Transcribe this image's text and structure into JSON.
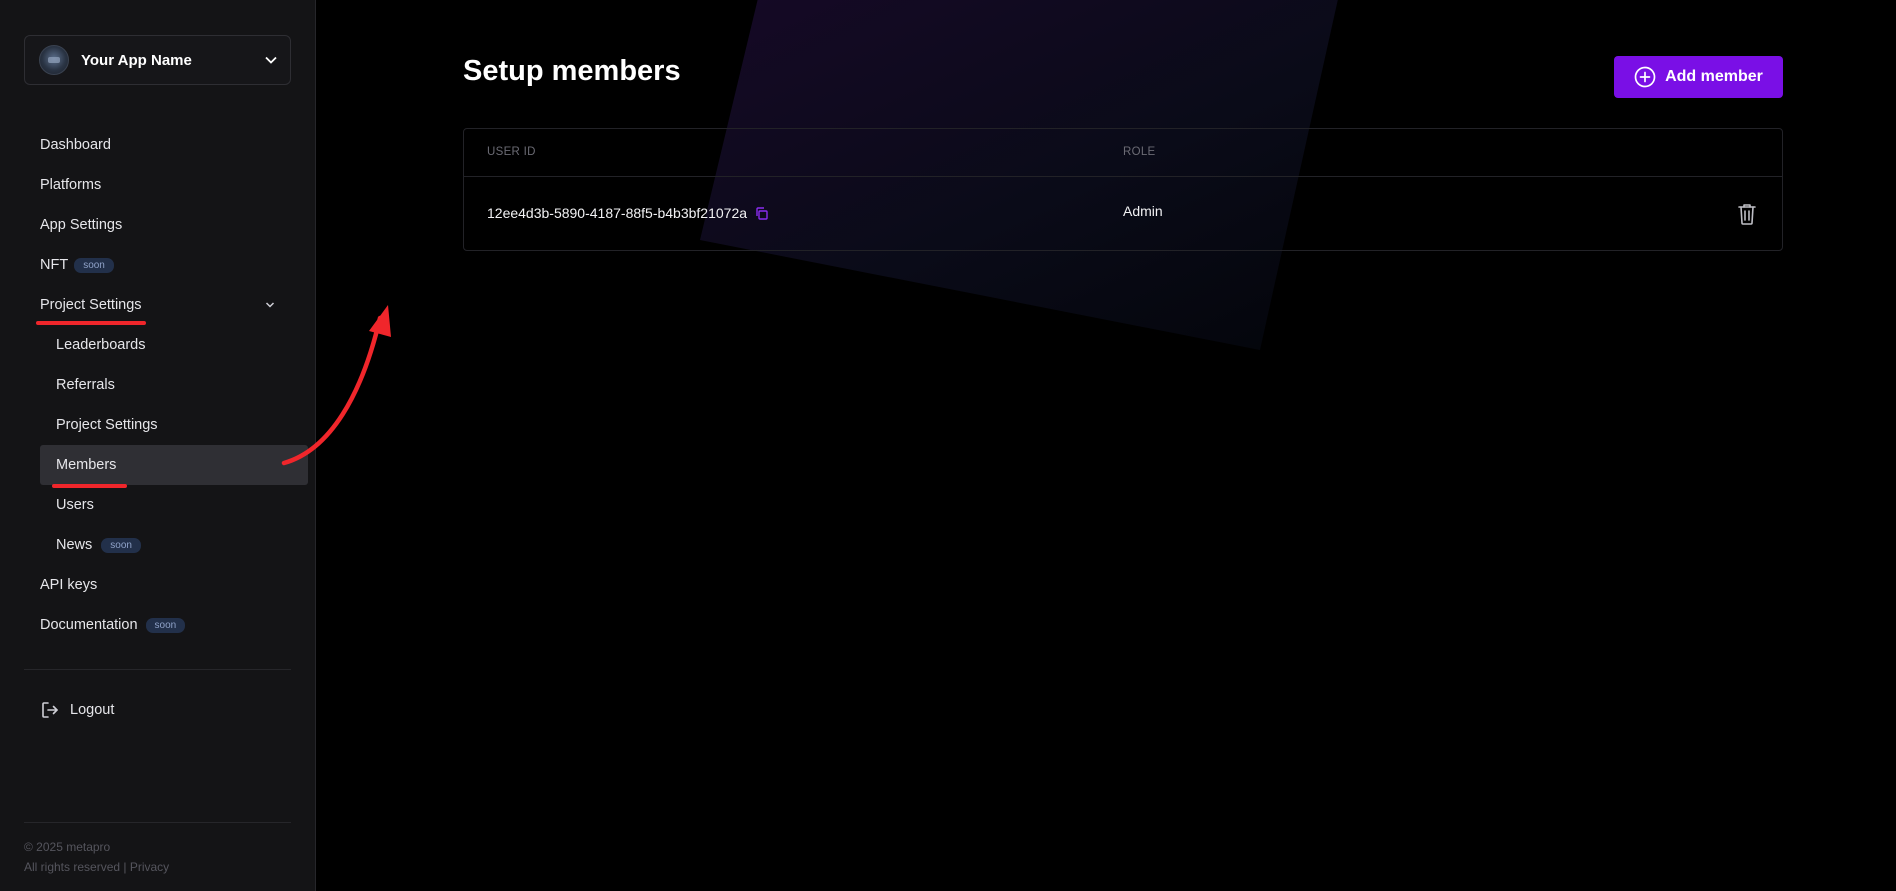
{
  "app_switcher": {
    "name": "Your App Name"
  },
  "sidebar": {
    "items": [
      {
        "label": "Dashboard"
      },
      {
        "label": "Platforms"
      },
      {
        "label": "App Settings"
      },
      {
        "label": "NFT",
        "badge": "soon"
      },
      {
        "label": "Project Settings"
      },
      {
        "label": "Leaderboards"
      },
      {
        "label": "Referrals"
      },
      {
        "label": "Project Settings"
      },
      {
        "label": "Members"
      },
      {
        "label": "Users"
      },
      {
        "label": "News",
        "badge": "soon"
      },
      {
        "label": "API keys"
      },
      {
        "label": "Documentation",
        "badge": "soon"
      }
    ],
    "logout": "Logout",
    "footer": {
      "copyright": "© 2025 metapro",
      "rights": "All rights reserved |",
      "privacy": "Privacy"
    }
  },
  "main": {
    "title": "Setup members",
    "add_button": "Add member",
    "table": {
      "headers": [
        "USER ID",
        "ROLE"
      ],
      "rows": [
        {
          "user_id": "12ee4d3b-5890-4187-88f5-b4b3bf21072a",
          "role": "Admin"
        }
      ]
    }
  },
  "colors": {
    "accent": "#7a0fe6",
    "annotation": "#f0262b"
  },
  "icons": [
    "chevron-down-icon",
    "logout-icon",
    "plus-circle-icon",
    "copy-icon",
    "trash-icon"
  ]
}
